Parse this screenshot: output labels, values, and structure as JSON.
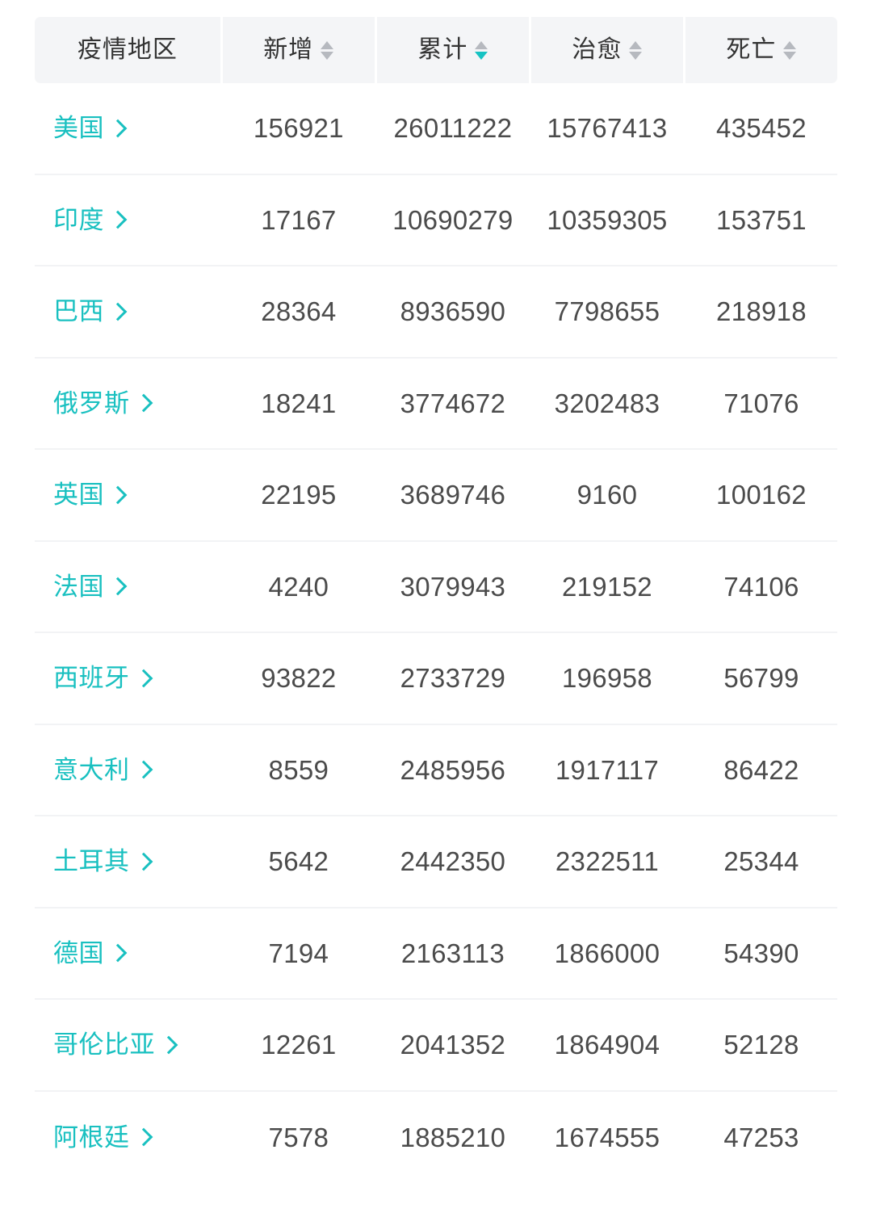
{
  "table": {
    "columns": [
      {
        "label": "疫情地区",
        "sortable": false,
        "sort_state": "none"
      },
      {
        "label": "新增",
        "sortable": true,
        "sort_state": "none"
      },
      {
        "label": "累计",
        "sortable": true,
        "sort_state": "desc"
      },
      {
        "label": "治愈",
        "sortable": true,
        "sort_state": "none"
      },
      {
        "label": "死亡",
        "sortable": true,
        "sort_state": "none"
      }
    ],
    "colors": {
      "accent": "#19c0c0",
      "header_bg": "#f4f5f7",
      "header_text": "#333333",
      "value_text": "#4b4b4b",
      "divider": "#f2f3f5",
      "arrow_inactive": "#b6b9bf",
      "arrow_active": "#16c3c3"
    },
    "rows": [
      {
        "region": "美国",
        "new": "156921",
        "total": "26011222",
        "cured": "15767413",
        "deaths": "435452"
      },
      {
        "region": "印度",
        "new": "17167",
        "total": "10690279",
        "cured": "10359305",
        "deaths": "153751"
      },
      {
        "region": "巴西",
        "new": "28364",
        "total": "8936590",
        "cured": "7798655",
        "deaths": "218918"
      },
      {
        "region": "俄罗斯",
        "new": "18241",
        "total": "3774672",
        "cured": "3202483",
        "deaths": "71076"
      },
      {
        "region": "英国",
        "new": "22195",
        "total": "3689746",
        "cured": "9160",
        "deaths": "100162"
      },
      {
        "region": "法国",
        "new": "4240",
        "total": "3079943",
        "cured": "219152",
        "deaths": "74106"
      },
      {
        "region": "西班牙",
        "new": "93822",
        "total": "2733729",
        "cured": "196958",
        "deaths": "56799"
      },
      {
        "region": "意大利",
        "new": "8559",
        "total": "2485956",
        "cured": "1917117",
        "deaths": "86422"
      },
      {
        "region": "土耳其",
        "new": "5642",
        "total": "2442350",
        "cured": "2322511",
        "deaths": "25344"
      },
      {
        "region": "德国",
        "new": "7194",
        "total": "2163113",
        "cured": "1866000",
        "deaths": "54390"
      },
      {
        "region": "哥伦比亚",
        "new": "12261",
        "total": "2041352",
        "cured": "1864904",
        "deaths": "52128"
      },
      {
        "region": "阿根廷",
        "new": "7578",
        "total": "1885210",
        "cured": "1674555",
        "deaths": "47253"
      }
    ]
  }
}
